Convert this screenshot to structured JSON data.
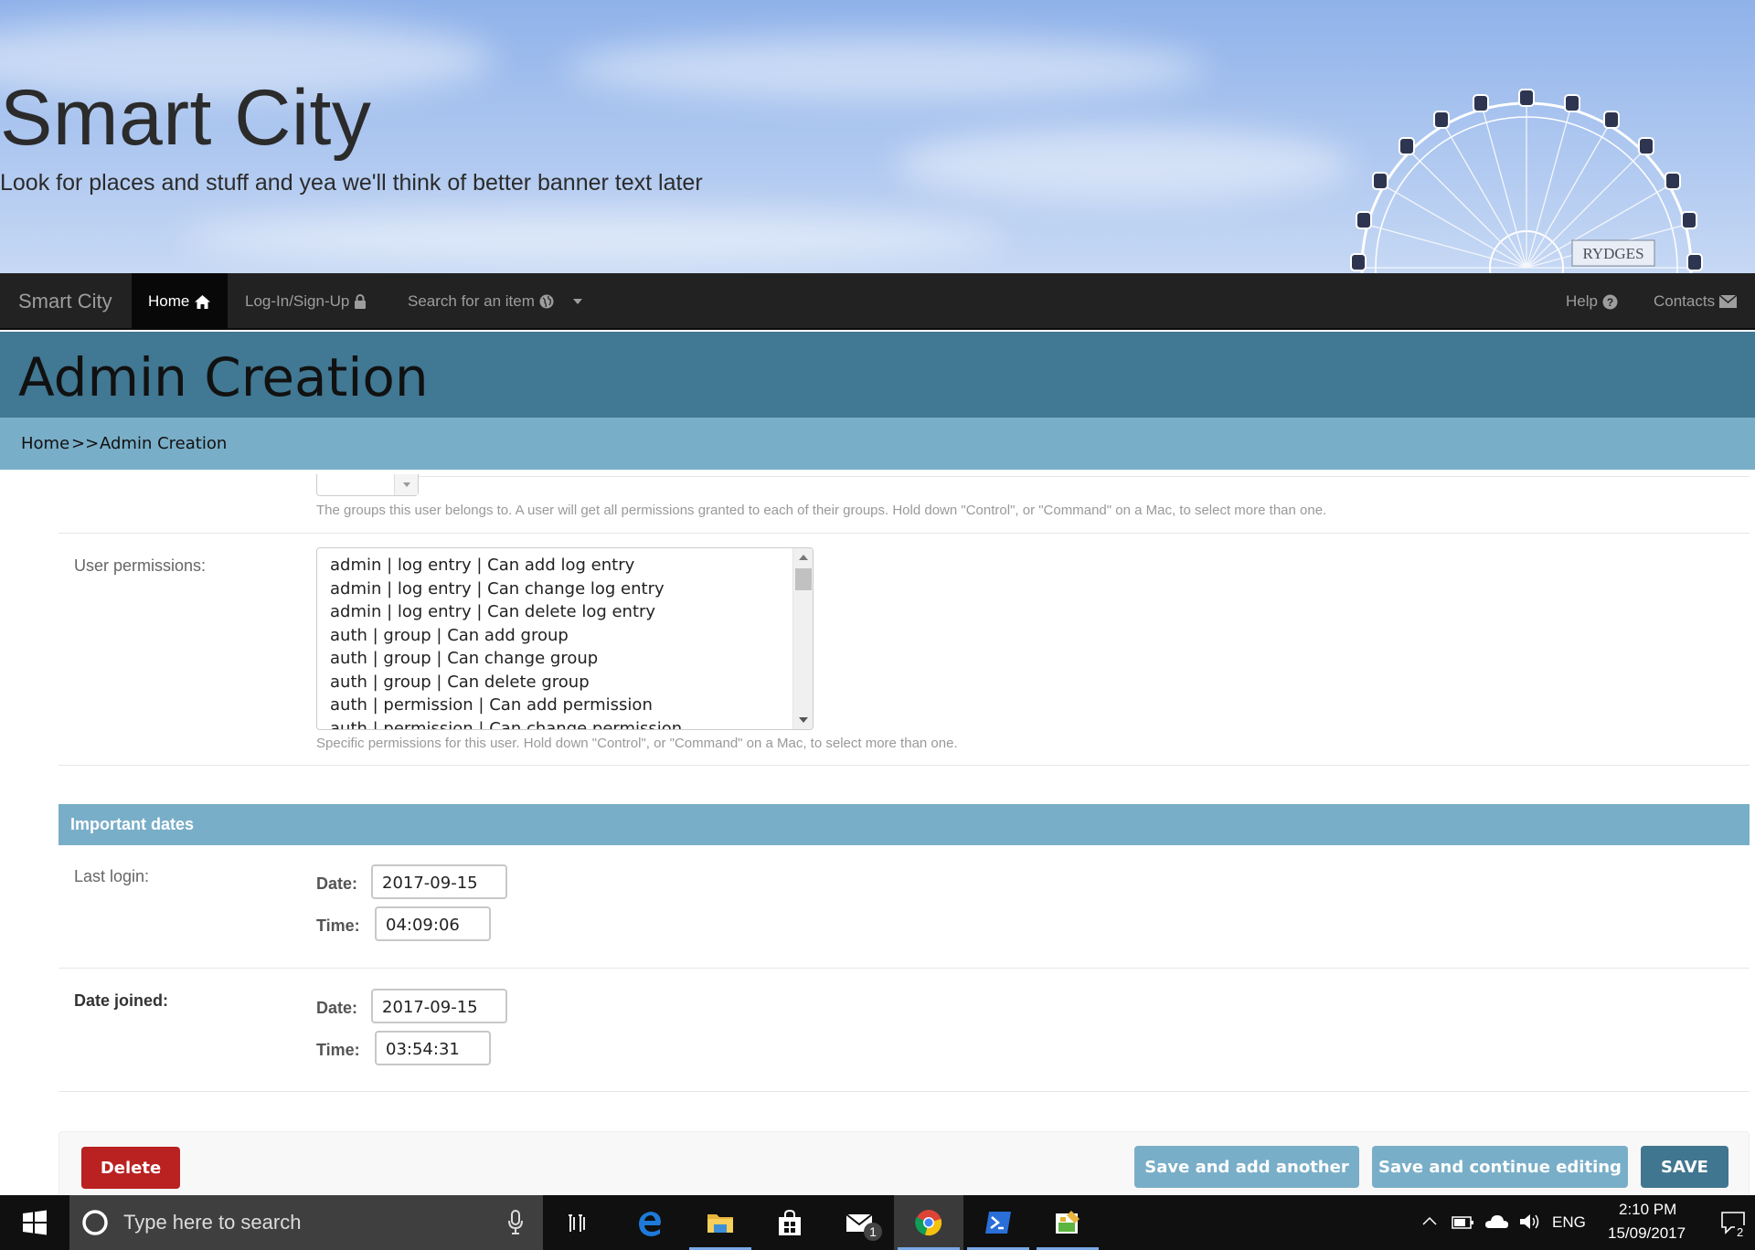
{
  "banner": {
    "title": "Smart City",
    "subtitle": "Look for places and stuff and yea we'll think of better banner text later",
    "sign_text": "RYDGES"
  },
  "navbar": {
    "brand": "Smart City",
    "items": [
      {
        "label": "Home",
        "icon": "home-icon",
        "active": true
      },
      {
        "label": "Log-In/Sign-Up",
        "icon": "lock-icon",
        "active": false
      },
      {
        "label": "Search for an item",
        "icon": "globe-icon",
        "active": false
      }
    ],
    "right_items": [
      {
        "label": "Help",
        "icon": "question-circle-icon"
      },
      {
        "label": "Contacts",
        "icon": "envelope-icon"
      }
    ]
  },
  "page": {
    "heading": "Admin Creation",
    "breadcrumb": {
      "home": "Home",
      "separator": ">>",
      "current": "Admin Creation"
    }
  },
  "form": {
    "groups_help": "The groups this user belongs to. A user will get all permissions granted to each of their groups. Hold down \"Control\", or \"Command\" on a Mac, to select more than one.",
    "permissions": {
      "label": "User permissions:",
      "options": [
        "admin | log entry | Can add log entry",
        "admin | log entry | Can change log entry",
        "admin | log entry | Can delete log entry",
        "auth | group | Can add group",
        "auth | group | Can change group",
        "auth | group | Can delete group",
        "auth | permission | Can add permission",
        "auth | permission | Can change permission"
      ],
      "help": "Specific permissions for this user. Hold down \"Control\", or \"Command\" on a Mac, to select more than one."
    },
    "important_dates": {
      "title": "Important dates",
      "last_login": {
        "label": "Last login:",
        "date_label": "Date:",
        "date": "2017-09-15",
        "time_label": "Time:",
        "time": "04:09:06"
      },
      "date_joined": {
        "label": "Date joined:",
        "date_label": "Date:",
        "date": "2017-09-15",
        "time_label": "Time:",
        "time": "03:54:31"
      }
    },
    "buttons": {
      "delete": "Delete",
      "save_add": "Save and add another",
      "save_continue": "Save and continue editing",
      "save": "SAVE"
    }
  },
  "taskbar": {
    "search_placeholder": "Type here to search",
    "mail_badge": "1",
    "language": "ENG",
    "time": "2:10 PM",
    "date": "15/09/2017",
    "notification_count": "2"
  },
  "colors": {
    "navbar": "#222222",
    "heading": "#417893",
    "breadcrumb": "#79aec8",
    "delete": "#ba2121",
    "save": "#417690"
  }
}
